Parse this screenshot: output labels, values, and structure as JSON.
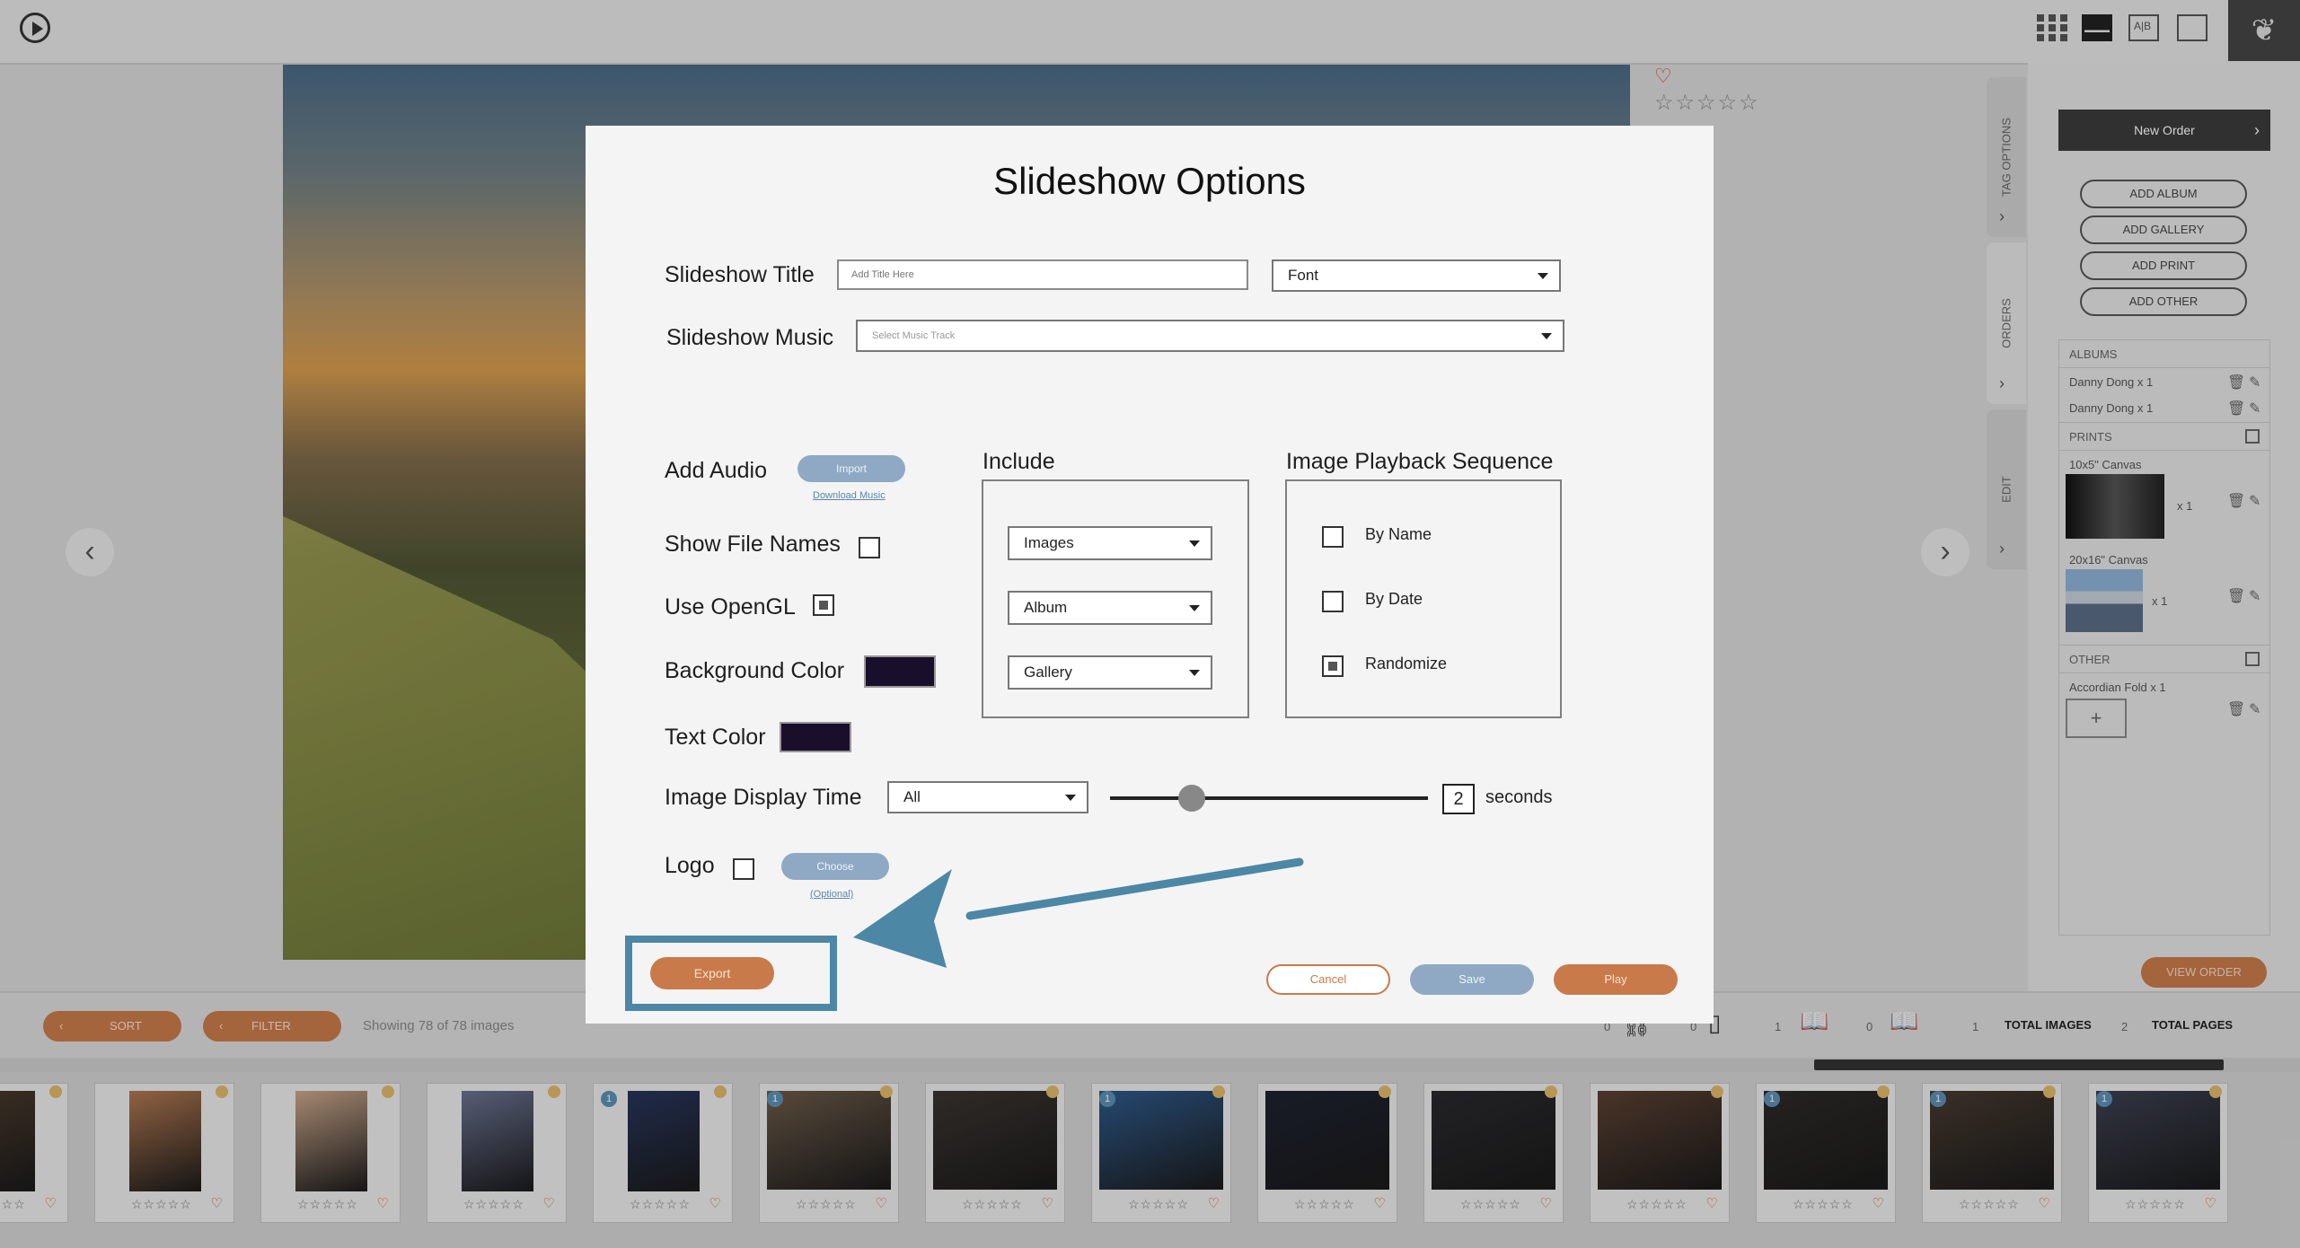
{
  "topbar": {
    "compare_icon_text": "A|B",
    "brand_glyph": "❦"
  },
  "photo_panel": {
    "rating": "☆☆☆☆☆",
    "heart": "♡",
    "prev": "‹",
    "next": "›"
  },
  "side_tabs": {
    "tag_options": "TAG OPTIONS",
    "orders": "ORDERS",
    "edit": "EDIT",
    "chevron": "›"
  },
  "order_panel": {
    "new_order": "New Order",
    "add_buttons": [
      "ADD ALBUM",
      "ADD GALLERY",
      "ADD PRINT",
      "ADD OTHER"
    ],
    "albums_header": "ALBUMS",
    "albums": [
      "Danny Dong x 1",
      "Danny Dong x 1"
    ],
    "prints_header": "PRINTS",
    "prints": [
      {
        "name": "10x5\" Canvas",
        "qty": "x 1"
      },
      {
        "name": "20x16\" Canvas",
        "qty": "x 1"
      }
    ],
    "other_header": "OTHER",
    "other_item": "Accordian Fold x 1",
    "add_plus": "+",
    "view_order": "VIEW ORDER"
  },
  "bottom_bar": {
    "sort": "SORT",
    "filter": "FILTER",
    "showing": "Showing 78 of 78 images",
    "counts": [
      "0",
      "0",
      "1",
      "0",
      "1",
      "2"
    ],
    "total_images": "TOTAL IMAGES",
    "total_pages": "TOTAL PAGES"
  },
  "filmstrip": {
    "stars": "☆☆☆☆☆",
    "heart": "♡",
    "badge": "1",
    "photo_colors": [
      "#4a3a2c",
      "#b07850",
      "#c9a78a",
      "#6a7290",
      "#27355a",
      "#6b5a48",
      "#3a3430",
      "#2e5a8a",
      "#1e2230",
      "#2a2a2e",
      "#5a4032",
      "#2d2a28",
      "#463a30",
      "#3c4050"
    ]
  },
  "modal": {
    "title": "Slideshow Options",
    "slideshow_title_label": "Slideshow Title",
    "slideshow_title_placeholder": "Add Title Here",
    "font_select": "Font",
    "slideshow_music_label": "Slideshow Music",
    "music_placeholder": "Select Music Track",
    "add_audio_label": "Add Audio",
    "import_button": "Import",
    "download_music_link": "Download Music",
    "show_file_names_label": "Show File Names",
    "use_opengl_label": "Use OpenGL",
    "background_color_label": "Background Color",
    "background_color": "#1a0f2a",
    "text_color_label": "Text Color",
    "text_color": "#1a0f2a",
    "image_display_time_label": "Image Display Time",
    "display_time_select": "All",
    "seconds_value": "2",
    "seconds_label": "seconds",
    "logo_label": "Logo",
    "choose_button": "Choose",
    "optional_link": "(Optional)",
    "include_label": "Include",
    "include_selects": [
      "Images",
      "Album",
      "Gallery"
    ],
    "playback_label": "Image Playback Sequence",
    "playback_options": [
      "By Name",
      "By Date",
      "Randomize"
    ],
    "export_button": "Export",
    "cancel_button": "Cancel",
    "save_button": "Save",
    "play_button": "Play",
    "accent_color": "#c97a4a",
    "highlight_color": "#4c87a6"
  }
}
